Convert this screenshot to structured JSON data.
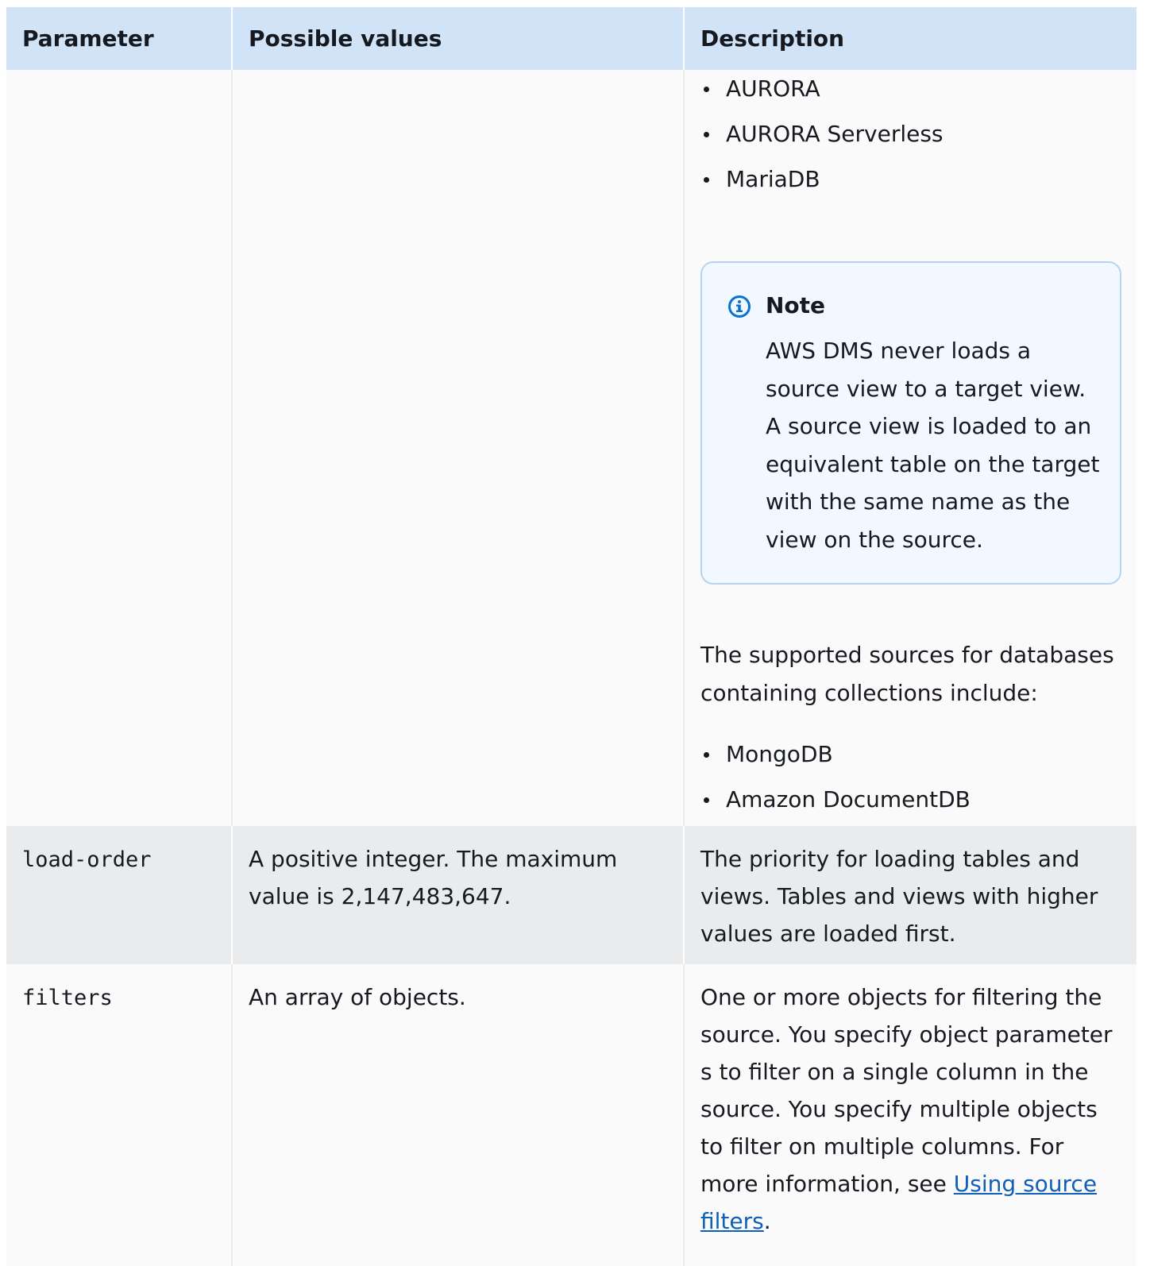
{
  "table": {
    "headers": [
      "Parameter",
      "Possible values",
      "Description"
    ],
    "continuation": {
      "bullets_top": [
        "AURORA",
        "AURORA Serverless",
        "MariaDB"
      ],
      "note": {
        "title": "Note",
        "text": "AWS DMS never loads a source view to a target view. A source view is loaded to an equivalent table on the target with the same name as the view on the source."
      },
      "paragraph": "The supported sources for databases containing collections include:",
      "bullets_bottom": [
        "MongoDB",
        "Amazon DocumentDB"
      ]
    },
    "rows": [
      {
        "parameter": "load-order",
        "values": "A positive integer. The maximum value is 2,147,483,647.",
        "description": "The priority for loading tables and views. Tables and views with higher values are loaded first."
      },
      {
        "parameter": "filters",
        "values": "An array of objects.",
        "description_prefix": "One or more objects for filtering the source. You specify object parameter s to filter on a single column in the source. You specify multiple objects to filter on multiple columns. For more information, see ",
        "description_link": "Using source filters",
        "description_suffix": "."
      }
    ]
  },
  "colors": {
    "header_bg": "#d1e4f7",
    "note_bg": "#f1f8ff",
    "note_border": "#b6d4f1",
    "info_icon": "#0972d3",
    "link": "#0f5fb8",
    "alt_row_bg": "#e9ebed"
  },
  "icons": {
    "note_icon": "info-circle-icon"
  }
}
